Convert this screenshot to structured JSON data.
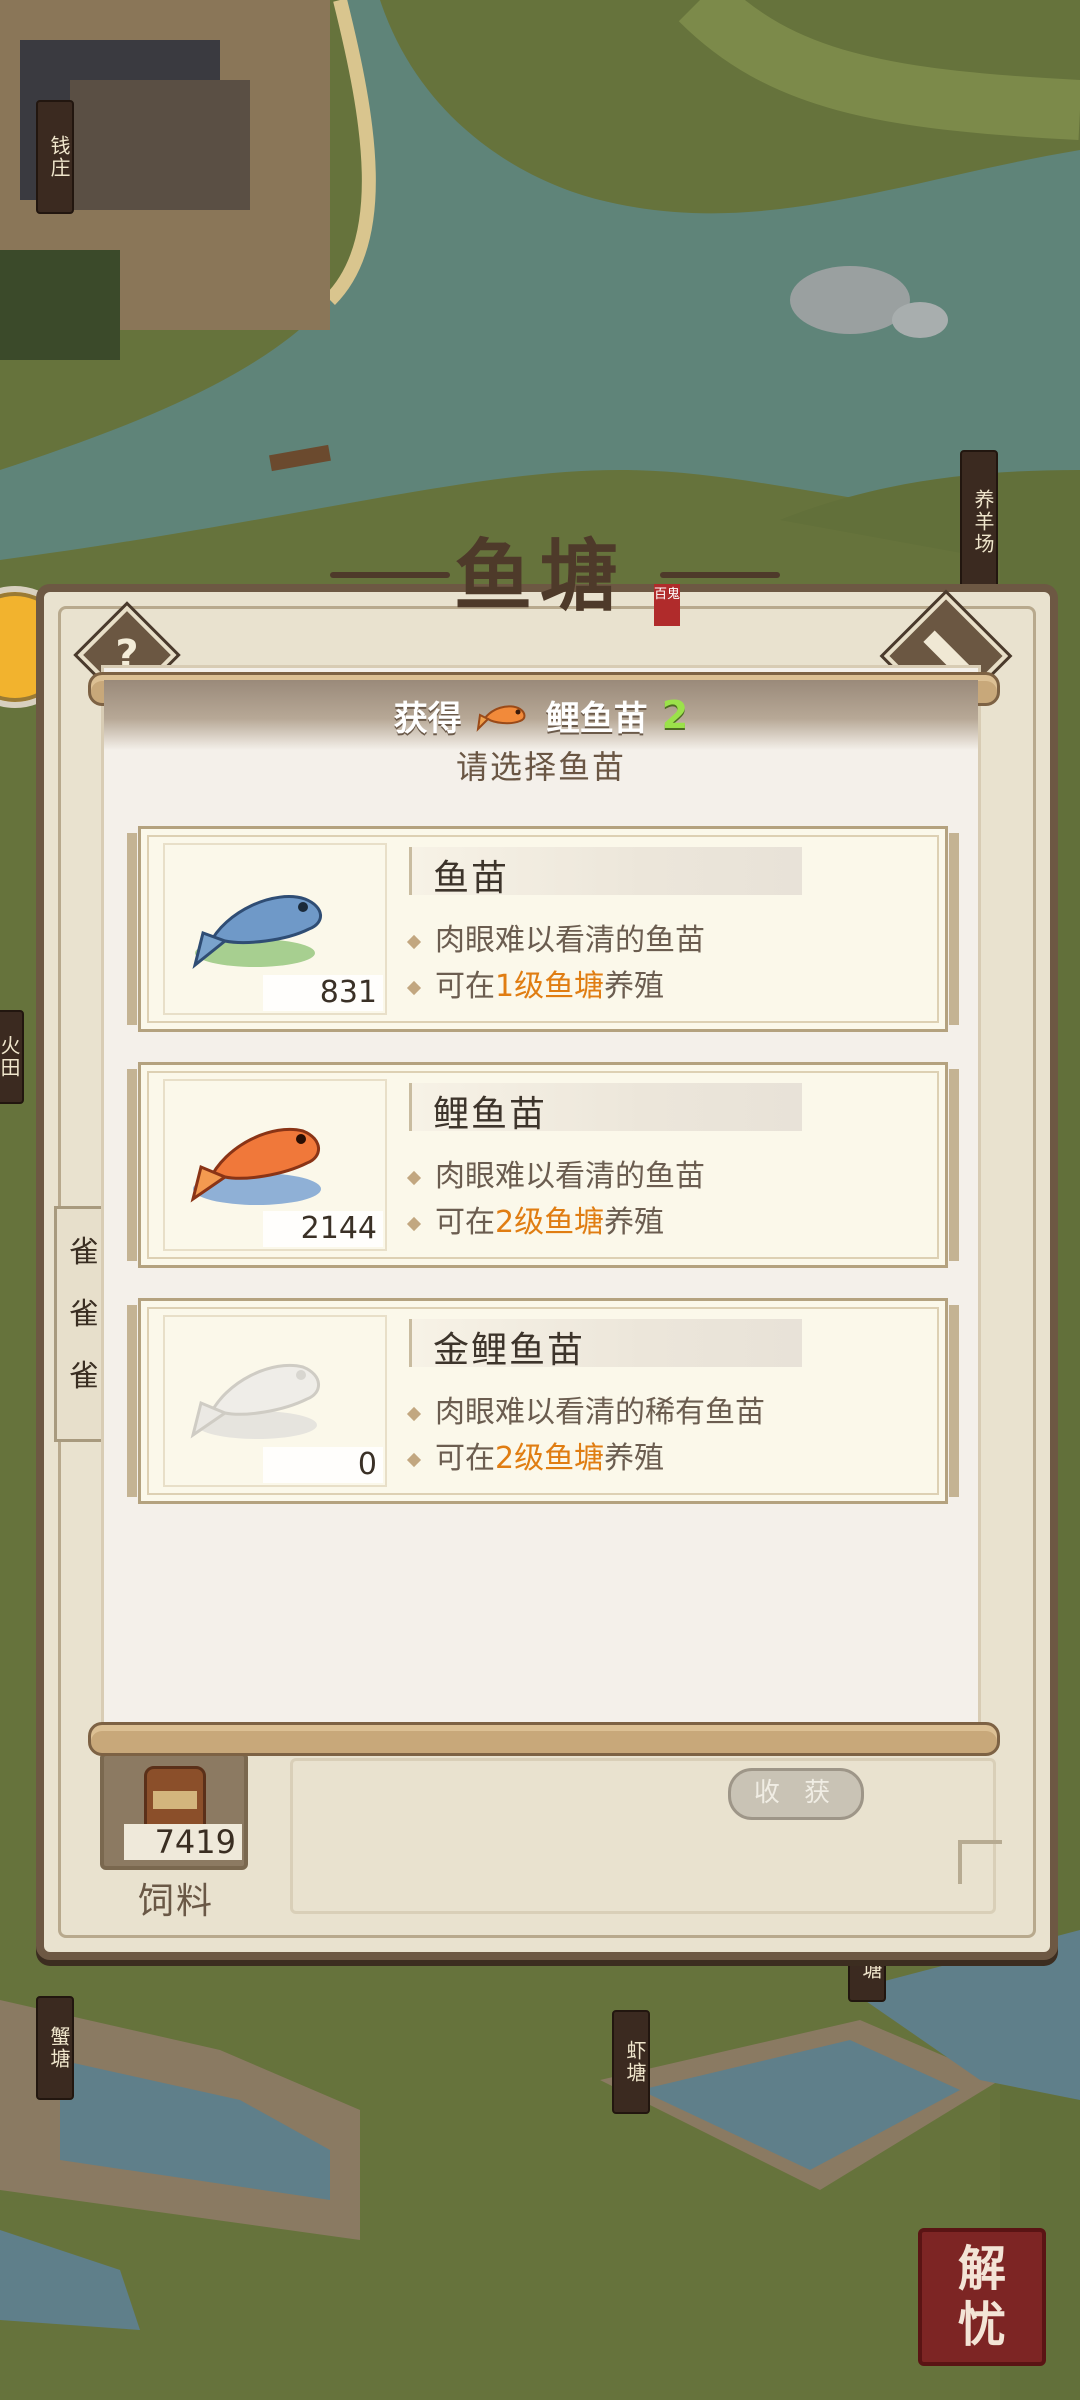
{
  "map": {
    "signs": {
      "money_house": "钱庄",
      "sheep_farm": "养羊场",
      "crab_pond": "蟹塘",
      "shrimp_pond": "虾塘",
      "pond_small": "塘",
      "field": "火田"
    },
    "seal_text_top": "解",
    "seal_text_bottom": "忧"
  },
  "panel": {
    "title": "鱼塘",
    "title_stamp": "百鬼",
    "help_label": "?",
    "left_tab_items": [
      "雀",
      "雀",
      "雀"
    ],
    "feed": {
      "count": "7419",
      "label": "饲料"
    },
    "harvest_label": "收 获"
  },
  "dialog": {
    "reward": {
      "prefix": "获得",
      "item": "鲤鱼苗",
      "amount": "2"
    },
    "subtitle": "请选择鱼苗",
    "items": [
      {
        "name": "鱼苗",
        "count": "831",
        "desc": "肉眼难以看清的鱼苗",
        "level_prefix": "可在",
        "level_highlight": "1级鱼塘",
        "level_suffix": "养殖",
        "icon": "blue-fish-icon"
      },
      {
        "name": "鲤鱼苗",
        "count": "2144",
        "desc": "肉眼难以看清的鱼苗",
        "level_prefix": "可在",
        "level_highlight": "2级鱼塘",
        "level_suffix": "养殖",
        "icon": "carp-fish-icon"
      },
      {
        "name": "金鲤鱼苗",
        "count": "0",
        "desc": "肉眼难以看清的稀有鱼苗",
        "level_prefix": "可在",
        "level_highlight": "2级鱼塘",
        "level_suffix": "养殖",
        "icon": "golden-carp-fish-icon"
      }
    ]
  },
  "colors": {
    "highlight": "#e07d12",
    "reward_amount": "#9be24a",
    "panel_border": "#6d5843"
  }
}
